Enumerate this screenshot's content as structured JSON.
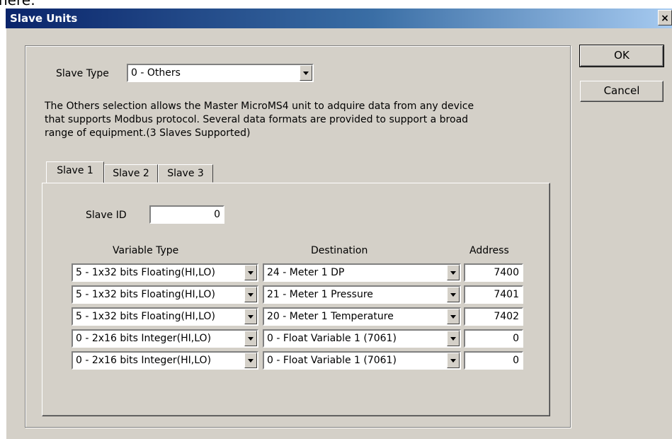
{
  "top_partial_text": "nere:",
  "window": {
    "title": "Slave Units",
    "close_glyph": "×"
  },
  "buttons": {
    "ok": "OK",
    "cancel": "Cancel"
  },
  "slave_type": {
    "label": "Slave Type",
    "value": "0 - Others"
  },
  "description": [
    "The Others selection allows the Master MicroMS4 unit to adquire data from any device",
    "that supports Modbus protocol. Several data formats are provided to support a broad",
    "range of equipment.(3 Slaves Supported)"
  ],
  "tabs": [
    {
      "label": "Slave 1",
      "active": true
    },
    {
      "label": "Slave 2",
      "active": false
    },
    {
      "label": "Slave 3",
      "active": false
    }
  ],
  "slave_id": {
    "label": "Slave ID",
    "value": "0"
  },
  "table": {
    "headers": {
      "variable_type": "Variable Type",
      "destination": "Destination",
      "address": "Address"
    },
    "rows": [
      {
        "variable_type": "5 - 1x32 bits Floating(HI,LO)",
        "destination": "24 - Meter 1 DP",
        "address": "7400"
      },
      {
        "variable_type": "5 - 1x32 bits Floating(HI,LO)",
        "destination": "21 - Meter 1 Pressure",
        "address": "7401"
      },
      {
        "variable_type": "5 - 1x32 bits Floating(HI,LO)",
        "destination": "20 - Meter 1 Temperature",
        "address": "7402"
      },
      {
        "variable_type": "0 - 2x16 bits Integer(HI,LO)",
        "destination": "0 - Float Variable 1 (7061)",
        "address": "0"
      },
      {
        "variable_type": "0 - 2x16 bits Integer(HI,LO)",
        "destination": "0 - Float Variable 1 (7061)",
        "address": "0"
      }
    ]
  },
  "colors": {
    "dialog_bg": "#d4d0c8",
    "title_start": "#0a246a",
    "title_end": "#a6caf0"
  }
}
